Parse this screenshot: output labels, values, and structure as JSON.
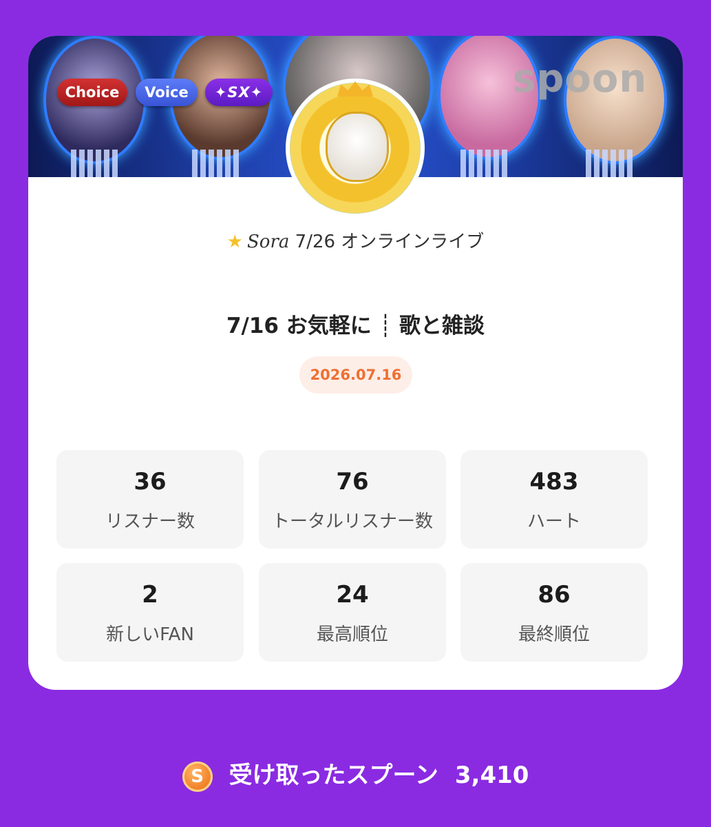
{
  "badges": {
    "choice": "Choice",
    "voice": "Voice",
    "sx": "✦SX✦"
  },
  "banner": {
    "logo_text": "spoon"
  },
  "profile": {
    "name": "Sora",
    "event": "7/26 オンラインライブ"
  },
  "live": {
    "title": "7/16 お気軽に ┊ 歌と雑談",
    "date": "2026.07.16"
  },
  "stats": [
    {
      "value": "36",
      "label": "リスナー数"
    },
    {
      "value": "76",
      "label": "トータルリスナー数"
    },
    {
      "value": "483",
      "label": "ハート"
    },
    {
      "value": "2",
      "label": "新しいFAN"
    },
    {
      "value": "24",
      "label": "最高順位"
    },
    {
      "value": "86",
      "label": "最終順位"
    }
  ],
  "footer": {
    "coin_symbol": "S",
    "label": "受け取ったスプーン",
    "amount": "3,410"
  },
  "colors": {
    "background": "#8a2be2",
    "accent": "#ee7033"
  }
}
